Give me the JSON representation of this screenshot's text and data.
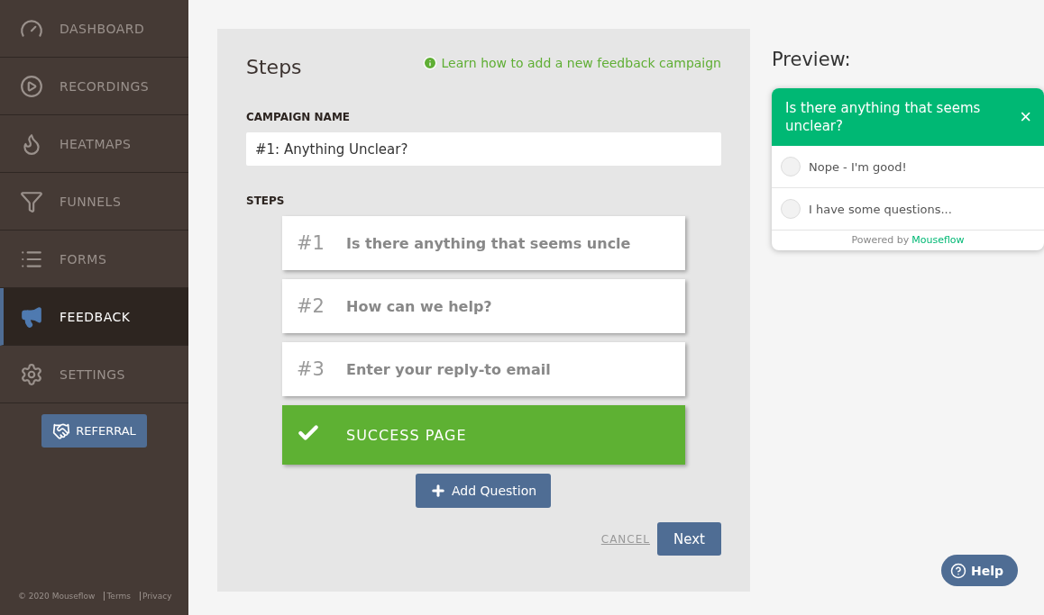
{
  "sidebar": {
    "items": [
      {
        "label": "DASHBOARD",
        "selected": false
      },
      {
        "label": "RECORDINGS",
        "selected": false
      },
      {
        "label": "HEATMAPS",
        "selected": false
      },
      {
        "label": "FUNNELS",
        "selected": false
      },
      {
        "label": "FORMS",
        "selected": false
      },
      {
        "label": "FEEDBACK",
        "selected": true
      },
      {
        "label": "SETTINGS",
        "selected": false
      }
    ],
    "referral": "REFERRAL",
    "footer": {
      "copyright": "© 2020 Mouseflow",
      "links": [
        "Terms",
        "Privacy"
      ]
    }
  },
  "editor": {
    "title": "Steps",
    "help_link": "Learn how to add a new feedback campaign",
    "campaign_label": "CAMPAIGN NAME",
    "campaign_name": "#1: Anything Unclear?",
    "steps_label": "STEPS",
    "steps": [
      {
        "kind": "question",
        "number": "#1",
        "text": "Is there anything that seems uncle"
      },
      {
        "kind": "question",
        "number": "#2",
        "text": "How can we help?"
      },
      {
        "kind": "question",
        "number": "#3",
        "text": "Enter your reply-to email"
      },
      {
        "kind": "success",
        "text": "SUCCESS PAGE"
      }
    ],
    "add_button": "Add Question",
    "cancel": "CANCEL",
    "next": "Next"
  },
  "preview": {
    "title": "Preview:",
    "question": "Is there anything that seems unclear?",
    "close": "×",
    "options": [
      {
        "label": "Nope - I'm good!",
        "selected": false
      },
      {
        "label": "I have some questions...",
        "selected": false
      }
    ],
    "powered_by": "Powered by",
    "brand": "Mouseflow"
  },
  "help_button": "Help"
}
